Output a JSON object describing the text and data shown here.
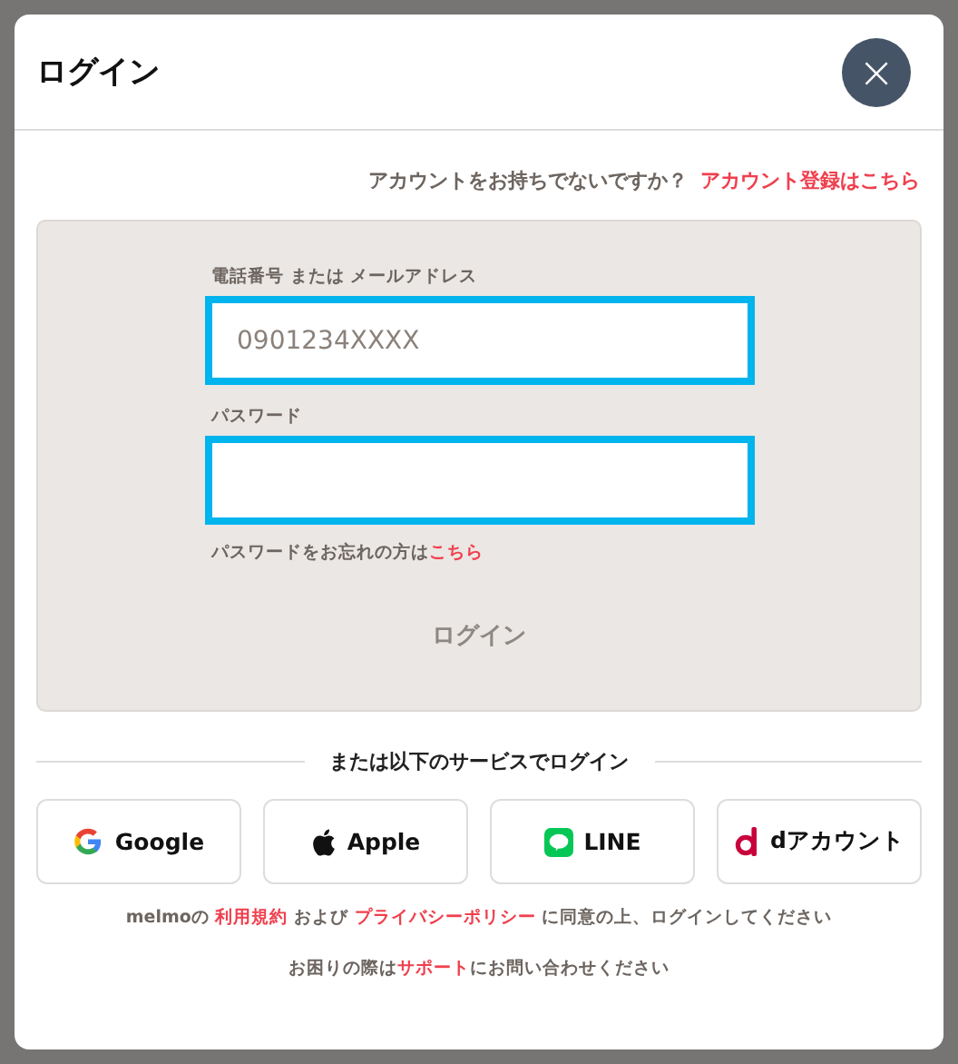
{
  "dialog": {
    "title": "ログイン",
    "close": "×"
  },
  "signup": {
    "question": "アカウントをお持ちでないですか？",
    "link": "アカウント登録はこちら"
  },
  "form": {
    "fields": [
      {
        "label": "電話番号 または メールアドレス",
        "placeholder": "0901234XXXX",
        "highlighted": true
      },
      {
        "label": "パスワード",
        "highlighted": true
      }
    ],
    "forgot": [
      {
        "text": "パスワードをお忘れの方は",
        "link": false
      },
      {
        "text": "こちら",
        "link": true
      }
    ],
    "submit": {
      "label": "ログイン",
      "disabled": true
    }
  },
  "divider": "または以下のサービスでログイン",
  "services": [
    {
      "kind": "google",
      "label": "Google"
    },
    {
      "kind": "apple",
      "label": "Apple"
    },
    {
      "kind": "line",
      "label": "LINE"
    },
    {
      "kind": "d",
      "label": "dアカウント"
    }
  ],
  "terms": [
    {
      "text": "melmoの ",
      "link": false
    },
    {
      "text": "利用規約",
      "link": true
    },
    {
      "text": " および ",
      "link": false
    },
    {
      "text": "プライバシーポリシー",
      "link": true
    },
    {
      "text": " に同意の上、ログインしてください",
      "link": false
    }
  ],
  "support": [
    {
      "text": "お困りの際は",
      "link": false
    },
    {
      "text": "サポート",
      "link": true
    },
    {
      "text": "にお問い合わせください",
      "link": false
    }
  ]
}
